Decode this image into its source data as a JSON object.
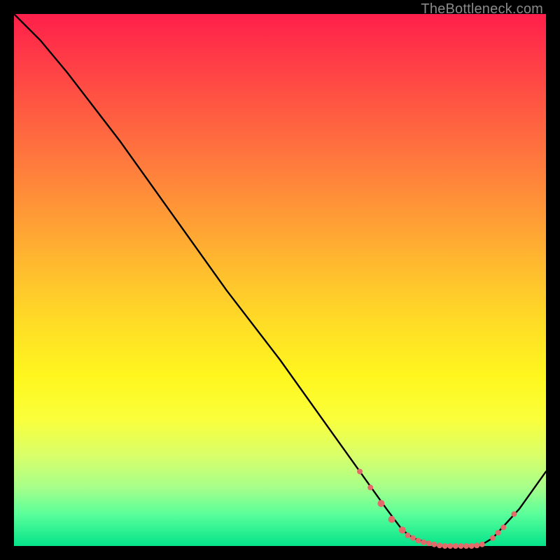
{
  "watermark": "TheBottleneck.com",
  "colors": {
    "background": "#000000",
    "line": "#000000",
    "dot": "#e36a6a",
    "gradient_top": "#ff1f4b",
    "gradient_bottom": "#05e38a"
  },
  "chart_data": {
    "type": "line",
    "title": "",
    "xlabel": "",
    "ylabel": "",
    "xlim": [
      0,
      100
    ],
    "ylim": [
      0,
      100
    ],
    "series": [
      {
        "name": "curve",
        "x": [
          0,
          5,
          10,
          20,
          30,
          40,
          50,
          60,
          65,
          70,
          73,
          75,
          78,
          80,
          82,
          84,
          86,
          88,
          90,
          95,
          100
        ],
        "y": [
          100,
          95,
          89,
          76,
          62,
          48,
          35,
          21,
          14,
          7,
          3,
          1.5,
          0.5,
          0,
          0,
          0,
          0,
          0.3,
          1.5,
          7,
          14
        ]
      }
    ],
    "dots": {
      "name": "markers",
      "points": [
        {
          "x": 65,
          "y": 14,
          "r": 4
        },
        {
          "x": 67,
          "y": 11,
          "r": 4
        },
        {
          "x": 69,
          "y": 8,
          "r": 5
        },
        {
          "x": 71,
          "y": 5,
          "r": 5
        },
        {
          "x": 73,
          "y": 3,
          "r": 5
        },
        {
          "x": 74,
          "y": 2,
          "r": 4
        },
        {
          "x": 75,
          "y": 1.5,
          "r": 4
        },
        {
          "x": 76,
          "y": 1,
          "r": 4
        },
        {
          "x": 77,
          "y": 0.7,
          "r": 4
        },
        {
          "x": 78,
          "y": 0.5,
          "r": 4
        },
        {
          "x": 79,
          "y": 0.3,
          "r": 4
        },
        {
          "x": 80,
          "y": 0.1,
          "r": 4
        },
        {
          "x": 81,
          "y": 0,
          "r": 4
        },
        {
          "x": 82,
          "y": 0,
          "r": 4
        },
        {
          "x": 83,
          "y": 0,
          "r": 4
        },
        {
          "x": 84,
          "y": 0,
          "r": 4
        },
        {
          "x": 85,
          "y": 0,
          "r": 4
        },
        {
          "x": 86,
          "y": 0,
          "r": 4
        },
        {
          "x": 87,
          "y": 0.1,
          "r": 4
        },
        {
          "x": 88,
          "y": 0.3,
          "r": 4
        },
        {
          "x": 90,
          "y": 1.5,
          "r": 4
        },
        {
          "x": 91,
          "y": 2.5,
          "r": 4
        },
        {
          "x": 92,
          "y": 3.5,
          "r": 4
        },
        {
          "x": 94,
          "y": 6,
          "r": 4
        }
      ]
    }
  }
}
